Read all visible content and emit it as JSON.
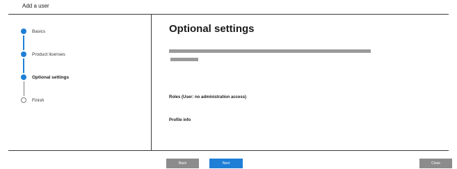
{
  "window": {
    "title": "Add a user"
  },
  "stepper": {
    "steps": [
      {
        "label": "Basics",
        "state": "complete"
      },
      {
        "label": "Product licenses",
        "state": "complete"
      },
      {
        "label": "Optional settings",
        "state": "current"
      },
      {
        "label": "Finish",
        "state": "pending"
      }
    ]
  },
  "main": {
    "title": "Optional settings",
    "roles_label": "Roles (User: no administration access)",
    "profile_label": "Profile info"
  },
  "footer": {
    "back_label": "Back",
    "next_label": "Next",
    "close_label": "Close"
  },
  "colors": {
    "accent": "#1f7fd6",
    "placeholder_bar": "#9a9a9a",
    "disabled_button": "#8c8c8c"
  }
}
